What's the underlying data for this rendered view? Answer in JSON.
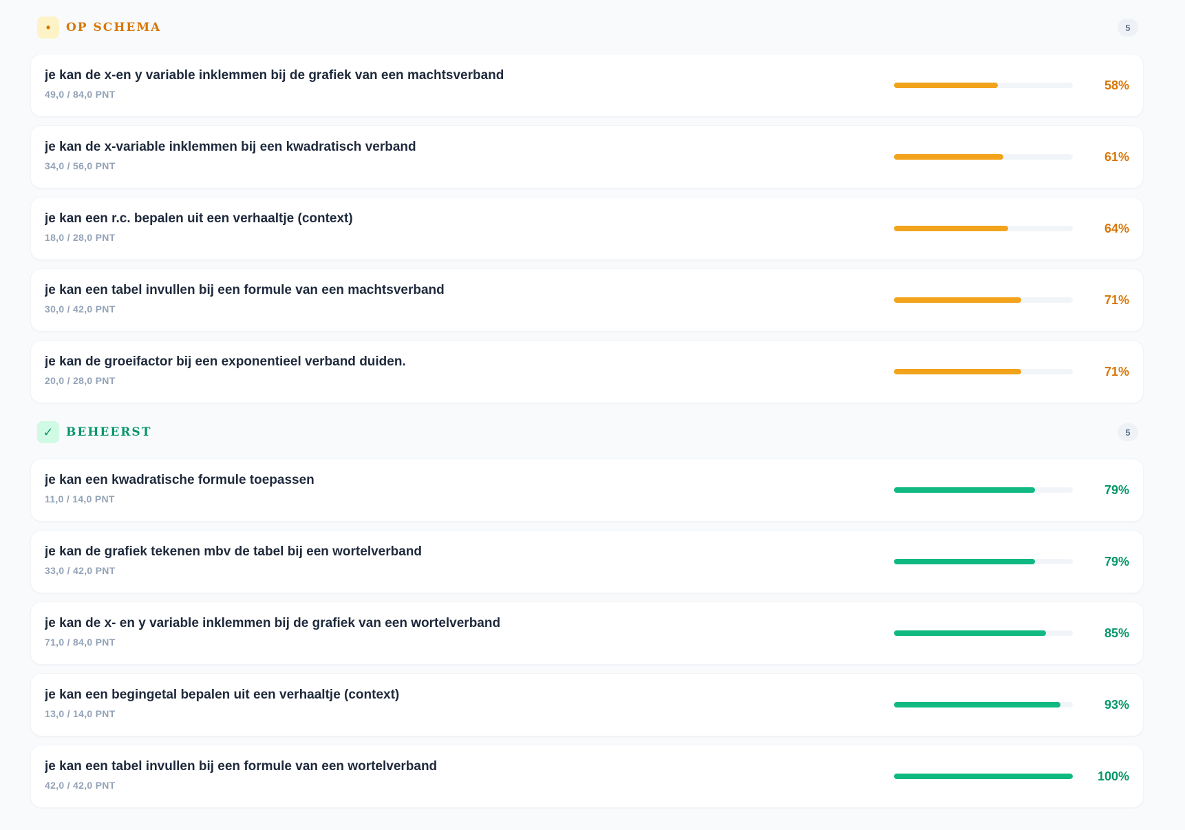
{
  "sections": [
    {
      "icon": "dot-icon",
      "icon_glyph": "•",
      "title": "OP SCHEMA",
      "count": "5",
      "color": "#d97706",
      "bar_color": "#f2a31b",
      "icon_bg": "#fef3c7",
      "items": [
        {
          "title": "je kan de x-en y variable inklemmen bij de grafiek van een machtsverband",
          "points": "49,0 / 84,0 PNT",
          "percent_label": "58%",
          "progress": 0.58
        },
        {
          "title": "je kan de x-variable inklemmen bij een kwadratisch verband",
          "points": "34,0 / 56,0 PNT",
          "percent_label": "61%",
          "progress": 0.61
        },
        {
          "title": "je kan een r.c. bepalen uit een verhaaltje (context)",
          "points": "18,0 / 28,0 PNT",
          "percent_label": "64%",
          "progress": 0.64
        },
        {
          "title": "je kan een tabel invullen bij een formule van een machtsverband",
          "points": "30,0 / 42,0 PNT",
          "percent_label": "71%",
          "progress": 0.71
        },
        {
          "title": "je kan de groeifactor bij een exponentieel verband duiden.",
          "points": "20,0 / 28,0 PNT",
          "percent_label": "71%",
          "progress": 0.71
        }
      ]
    },
    {
      "icon": "checkmark-icon",
      "icon_glyph": "✓",
      "title": "BEHEERST",
      "count": "5",
      "color": "#059669",
      "bar_color": "#10b981",
      "icon_bg": "#d1fae5",
      "items": [
        {
          "title": "je kan een kwadratische formule toepassen",
          "points": "11,0 / 14,0 PNT",
          "percent_label": "79%",
          "progress": 0.79
        },
        {
          "title": "je kan de grafiek tekenen mbv de tabel bij een wortelverband",
          "points": "33,0 / 42,0 PNT",
          "percent_label": "79%",
          "progress": 0.79
        },
        {
          "title": "je kan de x- en y variable inklemmen bij de grafiek van een wortelverband",
          "points": "71,0 / 84,0 PNT",
          "percent_label": "85%",
          "progress": 0.85
        },
        {
          "title": "je kan een begingetal bepalen uit een verhaaltje (context)",
          "points": "13,0 / 14,0 PNT",
          "percent_label": "93%",
          "progress": 0.93
        },
        {
          "title": "je kan een tabel invullen bij een formule van een wortelverband",
          "points": "42,0 / 42,0 PNT",
          "percent_label": "100%",
          "progress": 1.0
        }
      ]
    }
  ]
}
